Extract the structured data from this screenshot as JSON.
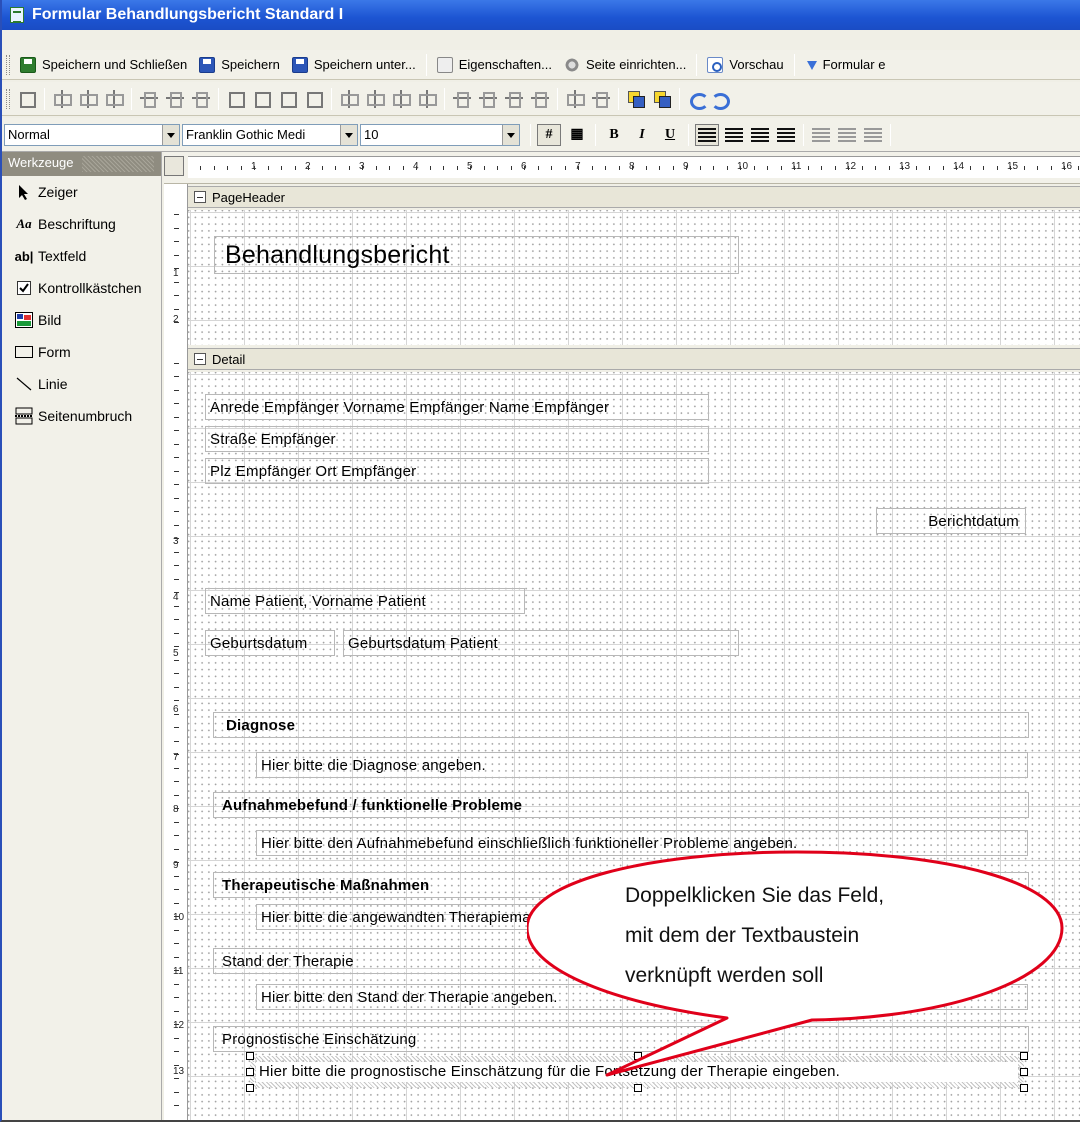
{
  "window": {
    "title": "Formular Behandlungsbericht Standard I"
  },
  "toolbar1": {
    "save_close": "Speichern und Schließen",
    "save": "Speichern",
    "save_as": "Speichern unter...",
    "properties": "Eigenschaften...",
    "page_setup": "Seite einrichten...",
    "preview": "Vorschau",
    "form_export": "Formular e"
  },
  "format": {
    "style": "Normal",
    "font": "Franklin Gothic Medi",
    "size": "10",
    "bold": "B",
    "italic": "I",
    "underline": "U"
  },
  "toolbox": {
    "title": "Werkzeuge",
    "items": [
      {
        "label": "Zeiger",
        "icon": "pointer-icon"
      },
      {
        "label": "Beschriftung",
        "icon": "label-icon"
      },
      {
        "label": "Textfeld",
        "icon": "textfield-icon"
      },
      {
        "label": "Kontrollkästchen",
        "icon": "checkbox-icon"
      },
      {
        "label": "Bild",
        "icon": "image-icon"
      },
      {
        "label": "Form",
        "icon": "shape-icon"
      },
      {
        "label": "Linie",
        "icon": "line-icon"
      },
      {
        "label": "Seitenumbruch",
        "icon": "pagebreak-icon"
      }
    ],
    "icon_glyphs": {
      "label": "Aa",
      "textfield": "ab|"
    }
  },
  "ruler": {
    "h": [
      "1",
      "2",
      "3",
      "4",
      "5",
      "6",
      "7",
      "8",
      "9",
      "10",
      "11",
      "12",
      "13",
      "14",
      "15",
      "16"
    ],
    "v": [
      "1",
      "2",
      "3",
      "4",
      "5",
      "6",
      "7",
      "8",
      "9",
      "10",
      "11",
      "12",
      "13"
    ]
  },
  "sections": {
    "header": "PageHeader",
    "detail": "Detail"
  },
  "header_title": "Behandlungsbericht",
  "fields": {
    "recipient_name": "Anrede Empfänger Vorname Empfänger Name Empfänger",
    "street": "Straße Empfänger",
    "city": "Plz Empfänger Ort Empfänger",
    "report_date": "Berichtdatum",
    "patient_name": "Name Patient, Vorname Patient",
    "dob_label": "Geburtsdatum",
    "dob_value": "Geburtsdatum Patient",
    "diagnosis_label": "Diagnose",
    "diagnosis_text": "Hier bitte die Diagnose angeben.",
    "findings_label": "Aufnahmebefund / funktionelle Probleme",
    "findings_text": "Hier bitte den Aufnahmebefund einschließlich funktioneller Probleme angeben.",
    "measures_label": "Therapeutische Maßnahmen",
    "measures_text": "Hier bitte die angewandten Therapiemaßnahmen angeben.",
    "state_label": "Stand der Therapie",
    "state_text": "Hier bitte den Stand der Therapie angeben.",
    "prognosis_label": "Prognostische Einschätzung",
    "prognosis_text": "Hier bitte die prognostische Einschätzung für die Fortsetzung der Therapie eingeben."
  },
  "callout": {
    "line1": "Doppelklicken Sie das Feld,",
    "line2": "mit dem der Textbaustein",
    "line3": "verknüpft werden soll"
  },
  "colors": {
    "titlebar": "#1c54d2",
    "callout_border": "#e0001a",
    "selection": "#bdbdbd"
  }
}
